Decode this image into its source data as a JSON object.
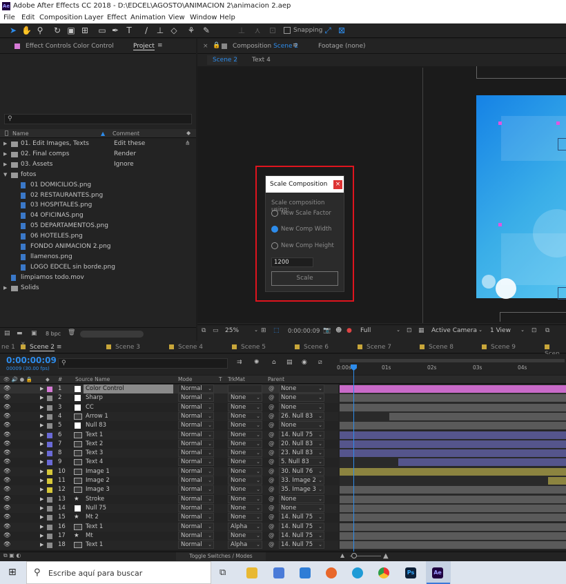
{
  "window": {
    "title": "Adobe After Effects CC 2018 - D:\\EDCEL\\AGOSTO\\ANIMACION 2\\animacion 2.aep",
    "icon": "Ae"
  },
  "menu": [
    "File",
    "Edit",
    "Composition",
    "Layer",
    "Effect",
    "Animation",
    "View",
    "Window",
    "Help"
  ],
  "toolbar": {
    "snapping_label": "Snapping"
  },
  "effect_controls": {
    "title": "Effect Controls Color Control"
  },
  "project": {
    "tab_label": "Project",
    "search_placeholder": "",
    "columns": {
      "name": "Name",
      "comment": "Comment"
    },
    "items": [
      {
        "name": "01. Edit Images, Texts",
        "comment": "Edit these",
        "type": "folder"
      },
      {
        "name": "02. Final comps",
        "comment": "Render",
        "type": "folder"
      },
      {
        "name": "03. Assets",
        "comment": "Ignore",
        "type": "folder"
      },
      {
        "name": "fotos",
        "comment": "",
        "type": "folder-open"
      },
      {
        "name": "01 DOMICILIOS.png",
        "comment": "",
        "type": "file"
      },
      {
        "name": "02 RESTAURANTES.png",
        "comment": "",
        "type": "file"
      },
      {
        "name": "03 HOSPITALES.png",
        "comment": "",
        "type": "file"
      },
      {
        "name": "04 OFICINAS.png",
        "comment": "",
        "type": "file"
      },
      {
        "name": "05 DEPARTAMENTOS.png",
        "comment": "",
        "type": "file"
      },
      {
        "name": "06 HOTELES.png",
        "comment": "",
        "type": "file"
      },
      {
        "name": "FONDO ANIMACION 2.png",
        "comment": "",
        "type": "file"
      },
      {
        "name": "llamenos.png",
        "comment": "",
        "type": "file"
      },
      {
        "name": "LOGO EDCEL sin borde.png",
        "comment": "",
        "type": "file"
      },
      {
        "name": "limpiamos todo.mov",
        "comment": "",
        "type": "file"
      },
      {
        "name": "Solids",
        "comment": "",
        "type": "folder"
      }
    ],
    "bpc": "8 bpc"
  },
  "composition": {
    "tab_prefix": "Composition",
    "tab_name": "Scene 2",
    "footage_label": "Footage (none)",
    "breadcrumbs": [
      "Scene 2",
      "Text 4"
    ],
    "footer": {
      "zoom": "25%",
      "time": "0:00:00:09",
      "resolution": "Full",
      "camera": "Active Camera",
      "view": "1 View"
    }
  },
  "dialog": {
    "title": "Scale Composition",
    "close": "×",
    "prompt": "Scale composition using:",
    "options": [
      {
        "label": "New Scale Factor",
        "selected": false
      },
      {
        "label": "New Comp Width",
        "selected": true
      },
      {
        "label": "New Comp Height",
        "selected": false
      }
    ],
    "value": "1200",
    "button": "Scale"
  },
  "timeline": {
    "tabs": [
      "ne 1",
      "Scene 2",
      "Scene 3",
      "Scene 4",
      "Scene 5",
      "Scene 6",
      "Scene 7",
      "Scene 8",
      "Scene 9",
      "Scen"
    ],
    "timecode": "0:00:00:09",
    "frames": "00009 (30.00 fps)",
    "headers": {
      "num": "#",
      "source": "Source Name",
      "mode": "Mode",
      "t": "T",
      "trkmat": "TrkMat",
      "parent": "Parent"
    },
    "ruler": [
      "0:00s",
      "01s",
      "02s",
      "03s",
      "04s"
    ],
    "toggle_label": "Toggle Switches / Modes",
    "layers": [
      {
        "n": "1",
        "name": "Color Control",
        "label": "#d67ad6",
        "type": "solid",
        "mode": "Normal",
        "trk": "",
        "parent": "None",
        "bar": "#c86ac8",
        "bar_start": 0
      },
      {
        "n": "2",
        "name": "Sharp",
        "label": "#8c8c8c",
        "type": "solid",
        "mode": "Normal",
        "trk": "None",
        "parent": "None",
        "bar": "#5a5a5a",
        "bar_start": 0
      },
      {
        "n": "3",
        "name": "CC",
        "label": "#8c8c8c",
        "type": "solid",
        "mode": "Normal",
        "trk": "None",
        "parent": "None",
        "bar": "#5a5a5a",
        "bar_start": 0
      },
      {
        "n": "4",
        "name": "Arrow 1",
        "label": "#8c8c8c",
        "type": "comp",
        "mode": "Normal",
        "trk": "None",
        "parent": "26. Null 83",
        "bar": "#5a5a5a",
        "bar_start": 0.22
      },
      {
        "n": "5",
        "name": "Null 83",
        "label": "#8c8c8c",
        "type": "solid",
        "mode": "Normal",
        "trk": "None",
        "parent": "None",
        "bar": "#5a5a5a",
        "bar_start": 0
      },
      {
        "n": "6",
        "name": "Text 1",
        "label": "#6a6ad6",
        "type": "comp",
        "mode": "Normal",
        "trk": "None",
        "parent": "14. Null 75",
        "bar": "#55558c",
        "bar_start": 0
      },
      {
        "n": "7",
        "name": "Text 2",
        "label": "#6a6ad6",
        "type": "comp",
        "mode": "Normal",
        "trk": "None",
        "parent": "20. Null 83",
        "bar": "#55558c",
        "bar_start": 0
      },
      {
        "n": "8",
        "name": "Text 3",
        "label": "#6a6ad6",
        "type": "comp",
        "mode": "Normal",
        "trk": "None",
        "parent": "23. Null 83",
        "bar": "#55558c",
        "bar_start": 0
      },
      {
        "n": "9",
        "name": "Text 4",
        "label": "#6a6ad6",
        "type": "comp",
        "mode": "Normal",
        "trk": "None",
        "parent": "5. Null 83",
        "bar": "#55558c",
        "bar_start": 0.26
      },
      {
        "n": "10",
        "name": "Image 1",
        "label": "#d6c83a",
        "type": "comp",
        "mode": "Normal",
        "trk": "None",
        "parent": "30. Null 76",
        "bar": "#8c8440",
        "bar_start": 0
      },
      {
        "n": "11",
        "name": "Image 2",
        "label": "#d6c83a",
        "type": "comp",
        "mode": "Normal",
        "trk": "None",
        "parent": "33. Image 2",
        "bar": "#8c8440",
        "bar_start": 0.92
      },
      {
        "n": "12",
        "name": "Image 3",
        "label": "#d6c83a",
        "type": "comp",
        "mode": "Normal",
        "trk": "None",
        "parent": "35. Image 3",
        "bar": "#5a5a5a",
        "bar_start": 0
      },
      {
        "n": "13",
        "name": "Stroke",
        "label": "#8c8c8c",
        "type": "shape",
        "mode": "Normal",
        "trk": "None",
        "parent": "None",
        "bar": "#5a5a5a",
        "bar_start": 0
      },
      {
        "n": "14",
        "name": "Null 75",
        "label": "#8c8c8c",
        "type": "solid",
        "mode": "Normal",
        "trk": "None",
        "parent": "None",
        "bar": "#5a5a5a",
        "bar_start": 0
      },
      {
        "n": "15",
        "name": "Mt 2",
        "label": "#8c8c8c",
        "type": "shape",
        "mode": "Normal",
        "trk": "None",
        "parent": "14. Null 75",
        "bar": "#5a5a5a",
        "bar_start": 0
      },
      {
        "n": "16",
        "name": "Text 1",
        "label": "#8c8c8c",
        "type": "comp",
        "mode": "Normal",
        "trk": "Alpha",
        "parent": "14. Null 75",
        "bar": "#5a5a5a",
        "bar_start": 0
      },
      {
        "n": "17",
        "name": "Mt",
        "label": "#8c8c8c",
        "type": "shape",
        "mode": "Normal",
        "trk": "None",
        "parent": "14. Null 75",
        "bar": "#5a5a5a",
        "bar_start": 0
      },
      {
        "n": "18",
        "name": "Text 1",
        "label": "#8c8c8c",
        "type": "comp",
        "mode": "Normal",
        "trk": "Alpha",
        "parent": "14. Null 75",
        "bar": "#5a5a5a",
        "bar_start": 0
      }
    ]
  },
  "taskbar": {
    "search_placeholder": "Escribe aquí para buscar"
  }
}
